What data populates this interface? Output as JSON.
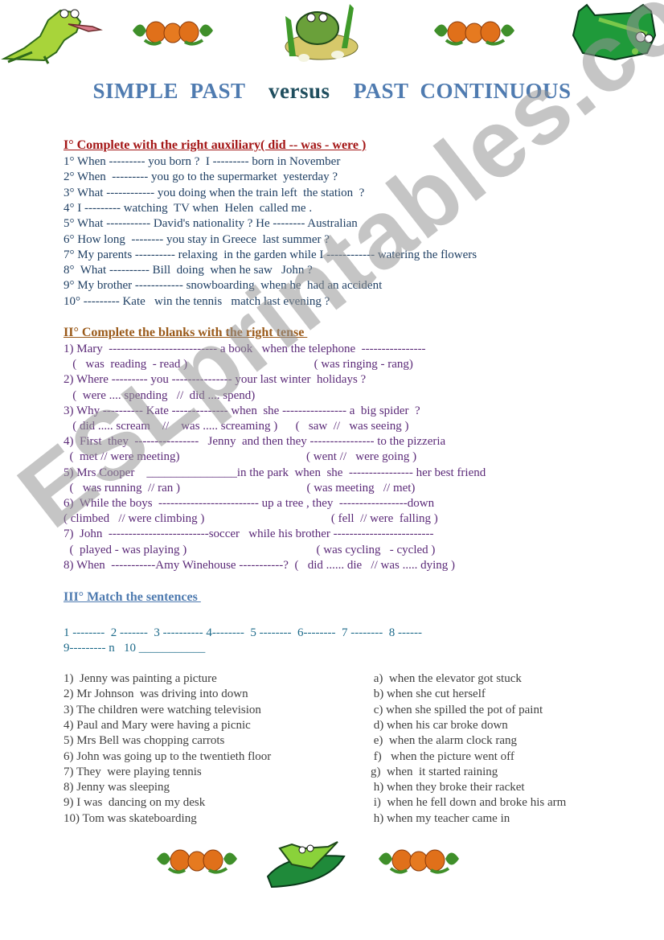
{
  "title": {
    "part1": "SIMPLE  PAST",
    "part2": "versus",
    "part3": "PAST  CONTINUOUS"
  },
  "colors": {
    "title_blue": "#4f7bb0",
    "title_dark": "#1f4e5e",
    "section1": "#a31515",
    "section2": "#9a5a1a",
    "section3": "#4f7bb0"
  },
  "section1": {
    "heading": "I° Complete with the right auxiliary( did -- was - were )",
    "lines": [
      "1° When --------- you born ?  I --------- born in November",
      "2° When  --------- you go to the supermarket  yesterday ?",
      "3° What ------------ you doing when the train left  the station  ?",
      "4° I --------- watching  TV when  Helen  called me .",
      "5° What ----------- David's nationality ? He -------- Australian",
      "6° How long  -------- you stay in Greece  last summer ?",
      "7° My parents ---------- relaxing  in the garden while I ------------ watering the flowers",
      "8°  What ---------- Bill  doing  when he saw   John ?",
      "9° My brother ------------ snowboarding  when he  had an accident",
      "10° --------- Kate   win the tennis   match last evening ?"
    ]
  },
  "section2": {
    "heading": "II° Complete the blanks with the right tense ",
    "lines": [
      "1) Mary  --------------------------- a book   when the telephone  ----------------",
      "   (   was  reading  - read )                                          ( was ringing - rang)",
      "2) Where --------- you --------------- your last winter  holidays ?",
      "   (  were .... spending   //  did .... spend)",
      "3) Why ---------- Kate -------------- when  she ---------------- a  big spider  ?",
      "   ( did ..... scream    //    was ..... screaming )      (   saw  //   was seeing )",
      "4)  First  they  ----------------   Jenny  and then they ---------------- to the pizzeria",
      "  (  met // were meeting)                                          ( went //   were going )",
      "5) Mrs Cooper    _______________in the park  when  she  ---------------- her best friend",
      "  (   was running  // ran )                                          ( was meeting   // met)",
      "6)  While the boys  ------------------------- up a tree , they  -----------------down",
      "( climbed   // were climbing )                                          ( fell  // were  falling )",
      "7)  John  -------------------------soccer   while his brother -------------------------",
      "  (  played - was playing )                                           ( was cycling   - cycled )",
      "8) When  -----------Amy Winehouse -----------?  (   did ...... die   // was ..... dying )"
    ]
  },
  "section3": {
    "heading": "III° Match the sentences ",
    "answer_line1": "1 --------  2 -------  3 ---------- 4--------  5 --------  6--------  7 --------  8 ------",
    "answer_line2": "9--------- n   10 ___________",
    "left": [
      "1)  Jenny was painting a picture",
      "2) Mr Johnson  was driving into down",
      "3) The children were watching television",
      "4) Paul and Mary were having a picnic",
      "5) Mrs Bell was chopping carrots",
      "6) John was going up to the twentieth floor",
      "7) They  were playing tennis",
      "8) Jenny was sleeping",
      "9) I was  dancing on my desk",
      "10) Tom was skateboarding"
    ],
    "right": [
      " a)  when the elevator got stuck",
      " b) when she cut herself",
      " c) when she spilled the pot of paint",
      " d) when his car broke down",
      " e)  when the alarm clock rang",
      " f)   when the picture went off",
      "g)  when  it started raining",
      " h) when they broke their racket",
      " i)  when he fell down and broke his arm",
      " h) when my teacher came in"
    ]
  },
  "watermark": "ESLprintables.com",
  "images": {
    "top": [
      "jumping-frog",
      "pumpkins",
      "frog-on-rock",
      "pumpkins",
      "green-frog"
    ],
    "bottom": [
      "pumpkins",
      "frog-on-leaf",
      "pumpkins"
    ]
  }
}
